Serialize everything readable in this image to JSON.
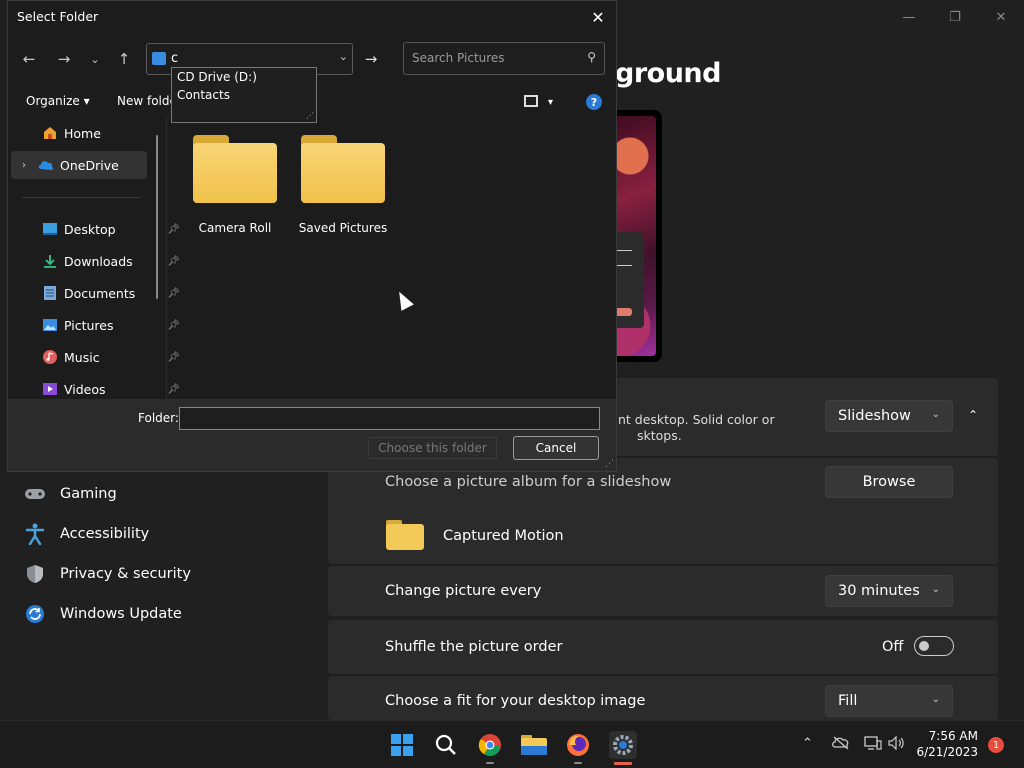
{
  "settings": {
    "page_title": "ground",
    "window_controls": [
      "—",
      "❐",
      "✕"
    ],
    "nav": [
      {
        "label": "Gaming",
        "icon": "gamepad-icon"
      },
      {
        "label": "Accessibility",
        "icon": "accessibility-icon"
      },
      {
        "label": "Privacy & security",
        "icon": "shield-icon"
      },
      {
        "label": "Windows Update",
        "icon": "update-icon"
      }
    ],
    "personalize_desc_line1": "nt desktop. Solid color or",
    "personalize_desc_line2": "sktops.",
    "background_type": "Slideshow",
    "album_prompt": "Choose a picture album for a slideshow",
    "browse_label": "Browse",
    "album_name": "Captured Motion",
    "change_every_label": "Change picture every",
    "change_every_value": "30 minutes",
    "shuffle_label": "Shuffle the picture order",
    "shuffle_state": "Off",
    "fit_label": "Choose a fit for your desktop image",
    "fit_value": "Fill"
  },
  "dialog": {
    "title": "Select Folder",
    "address_text": "c",
    "search_placeholder": "Search Pictures",
    "suggestions": [
      "CD Drive (D:)",
      "Contacts"
    ],
    "organize_label": "Organize",
    "new_folder_label": "New folde",
    "sidebar": [
      {
        "label": "Home",
        "icon": "home-icon"
      },
      {
        "label": "OneDrive",
        "icon": "onedrive-icon"
      },
      {
        "label": "Desktop",
        "icon": "desktop-icon"
      },
      {
        "label": "Downloads",
        "icon": "downloads-icon"
      },
      {
        "label": "Documents",
        "icon": "documents-icon"
      },
      {
        "label": "Pictures",
        "icon": "pictures-icon"
      },
      {
        "label": "Music",
        "icon": "music-icon"
      },
      {
        "label": "Videos",
        "icon": "videos-icon"
      }
    ],
    "folders": [
      "Camera Roll",
      "Saved Pictures"
    ],
    "folder_label": "Folder:",
    "folder_value": "",
    "choose_label": "Choose this folder",
    "cancel_label": "Cancel"
  },
  "taskbar": {
    "apps": [
      "start-icon",
      "search-icon",
      "chrome-icon",
      "file-explorer-icon",
      "firefox-icon",
      "settings-icon"
    ],
    "time": "7:56 AM",
    "date": "6/21/2023",
    "notification_count": "1"
  },
  "colors": {
    "accent": "#2b7bd4",
    "folder": "#f0c24a",
    "bg": "#202020"
  }
}
